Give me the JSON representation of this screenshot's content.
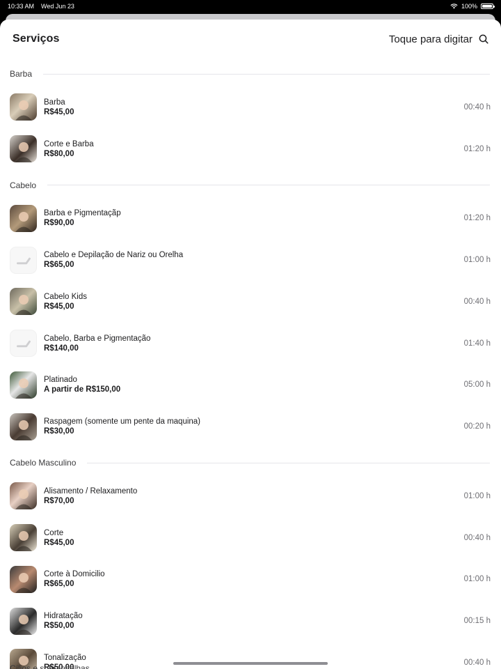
{
  "status_bar": {
    "time": "10:33 AM",
    "date": "Wed Jun 23",
    "battery": "100%"
  },
  "header": {
    "title": "Serviços",
    "search_hint": "Toque para digitar"
  },
  "sections": [
    {
      "title": "Barba",
      "items": [
        {
          "name": "Barba",
          "price": "R$45,00",
          "duration": "00:40 h",
          "thumb": "photo"
        },
        {
          "name": "Corte e Barba",
          "price": "R$80,00",
          "duration": "01:20 h",
          "thumb": "photo"
        }
      ]
    },
    {
      "title": "Cabelo",
      "items": [
        {
          "name": "Barba e  Pigmentaçãp",
          "price": "R$90,00",
          "duration": "01:20 h",
          "thumb": "photo"
        },
        {
          "name": "Cabelo e Depilação de Nariz ou Orelha",
          "price": "R$65,00",
          "duration": "01:00 h",
          "thumb": "placeholder"
        },
        {
          "name": "Cabelo Kids",
          "price": "R$45,00",
          "duration": "00:40 h",
          "thumb": "photo"
        },
        {
          "name": "Cabelo, Barba e Pigmentação",
          "price": "R$140,00",
          "duration": "01:40 h",
          "thumb": "placeholder"
        },
        {
          "name": "Platinado",
          "price": "A partir de R$150,00",
          "duration": "05:00 h",
          "thumb": "photo"
        },
        {
          "name": "Raspagem (somente um pente da maquina)",
          "price": "R$30,00",
          "duration": "00:20 h",
          "thumb": "photo"
        }
      ]
    },
    {
      "title": "Cabelo Masculino",
      "items": [
        {
          "name": "Alisamento / Relaxamento",
          "price": "R$70,00",
          "duration": "01:00 h",
          "thumb": "photo"
        },
        {
          "name": "Corte",
          "price": "R$45,00",
          "duration": "00:40 h",
          "thumb": "photo"
        },
        {
          "name": "Corte à Domicilio",
          "price": "R$65,00",
          "duration": "01:00 h",
          "thumb": "photo"
        },
        {
          "name": "Hidratação",
          "price": "R$50,00",
          "duration": "00:15 h",
          "thumb": "photo"
        },
        {
          "name": "Tonalização",
          "price": "R$50,00",
          "duration": "00:40 h",
          "thumb": "photo"
        }
      ]
    }
  ],
  "next_section_partial": "Cílios e sobrancelhas"
}
